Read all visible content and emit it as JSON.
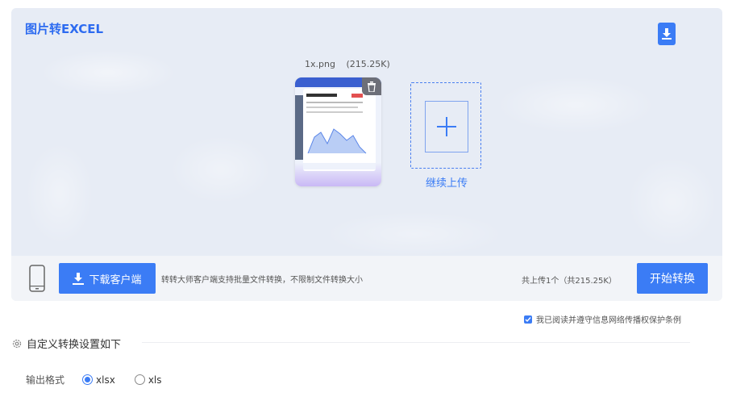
{
  "panel": {
    "title": "图片转EXCEL",
    "file": {
      "name": "1x.png",
      "size": "(215.25K)"
    },
    "add_more_label": "继续上传"
  },
  "action_bar": {
    "client_button": "下载客户端",
    "client_note": "转转大师客户端支持批量文件转换，不限制文件转换大小",
    "upload_count": "共上传1个（共215.25K）",
    "start_button": "开始转换"
  },
  "agreement": {
    "checked": true,
    "text": "我已阅读并遵守信息网络传播权保护条例"
  },
  "settings": {
    "title": "自定义转换设置如下",
    "format_label": "输出格式",
    "options": [
      {
        "label": "xlsx",
        "selected": true
      },
      {
        "label": "xls",
        "selected": false
      }
    ]
  },
  "icons": [
    "download-icon",
    "trash-icon",
    "plus-icon",
    "phone-icon",
    "gear-icon",
    "check-icon"
  ],
  "colors": {
    "accent": "#3b7cf5",
    "panel_bg": "#e7ecf5",
    "bar_bg": "#f2f4f8"
  }
}
